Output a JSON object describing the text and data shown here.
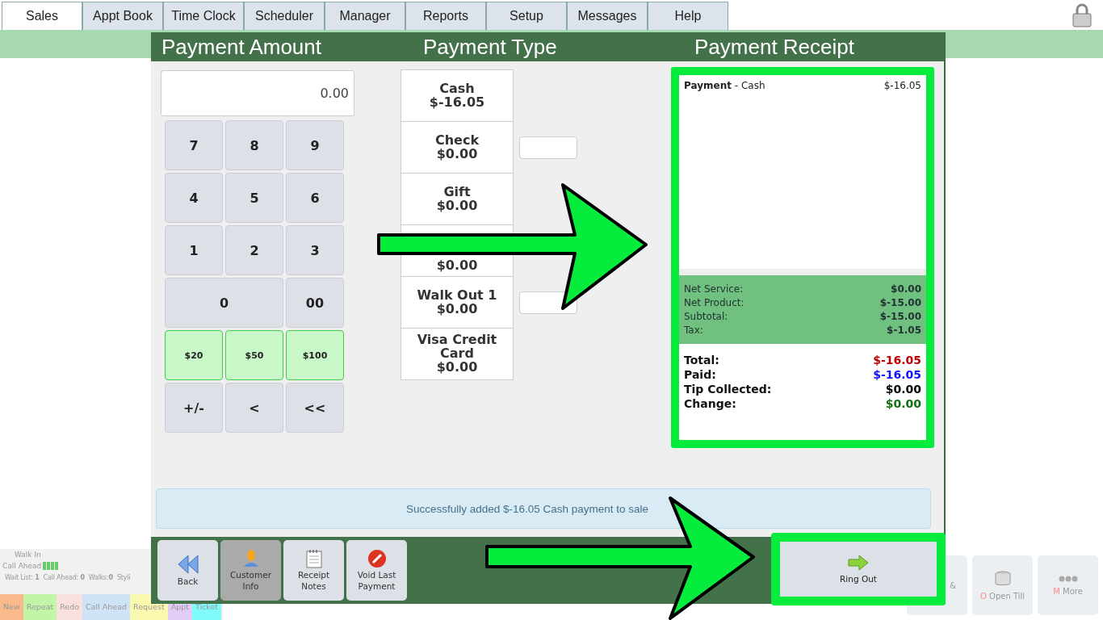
{
  "tabs": [
    {
      "label": "Sales",
      "selected": true
    },
    {
      "label": "Appt Book",
      "selected": false
    },
    {
      "label": "Time Clock",
      "selected": false
    },
    {
      "label": "Scheduler",
      "selected": false
    },
    {
      "label": "Manager",
      "selected": false
    },
    {
      "label": "Reports",
      "selected": false
    },
    {
      "label": "Setup",
      "selected": false
    },
    {
      "label": "Messages",
      "selected": false
    },
    {
      "label": "Help",
      "selected": false
    }
  ],
  "queue": {
    "walk_in_label": "Walk In",
    "call_ahead_label": "Call Ahead",
    "stats": [
      "Wait List: **1**",
      "Call Ahead: **0**",
      "Walks:**0**",
      "Styli"
    ],
    "types": [
      {
        "label": "New",
        "color": "#f9b98a"
      },
      {
        "label": "Repeat",
        "color": "#c2f5a8"
      },
      {
        "label": "Redo",
        "color": "#fbe0e0"
      },
      {
        "label": "Call Ahead",
        "color": "#cfe3f7"
      },
      {
        "label": "Request",
        "color": "#fbf8b0"
      },
      {
        "label": "Appt",
        "color": "#e2cdf7"
      },
      {
        "label": "Ticket",
        "color": "#80fbfb"
      }
    ]
  },
  "background_actions": [
    {
      "label": "&"
    },
    {
      "hotkey": "O",
      "label": "Open Till"
    },
    {
      "hotkey": "M",
      "label": "More"
    }
  ],
  "modal": {
    "headers": [
      "Payment Amount",
      "Payment Type",
      "Payment Receipt"
    ],
    "amount": {
      "value": "0.00"
    },
    "keys": [
      {
        "label": "7",
        "kind": "digit"
      },
      {
        "label": "8",
        "kind": "digit"
      },
      {
        "label": "9",
        "kind": "digit"
      },
      {
        "label": "4",
        "kind": "digit"
      },
      {
        "label": "5",
        "kind": "digit"
      },
      {
        "label": "6",
        "kind": "digit"
      },
      {
        "label": "1",
        "kind": "digit"
      },
      {
        "label": "2",
        "kind": "digit"
      },
      {
        "label": "3",
        "kind": "digit"
      },
      {
        "label": "0",
        "kind": "wide"
      },
      {
        "label": "00",
        "kind": "digit"
      },
      {
        "label": "$20",
        "kind": "cash"
      },
      {
        "label": "$50",
        "kind": "cash"
      },
      {
        "label": "$100",
        "kind": "cash"
      },
      {
        "label": "+/-",
        "kind": "digit"
      },
      {
        "label": "<",
        "kind": "digit"
      },
      {
        "label": "<<",
        "kind": "digit"
      }
    ],
    "payment_types": [
      {
        "name": "Cash",
        "amount": "$-16.05",
        "has_field": false
      },
      {
        "name": "Check",
        "amount": "$0.00",
        "has_field": true
      },
      {
        "name": "Gift",
        "amount": "$0.00",
        "has_field": false
      },
      {
        "amount": "$0.00",
        "has_field": false
      },
      {
        "name": "Walk Out 1",
        "amount": "$0.00",
        "has_field": true
      },
      {
        "name": "Visa Credit Card",
        "amount": "$0.00",
        "has_field": false
      }
    ],
    "receipt": {
      "line": {
        "label": "Payment",
        "separator": "-",
        "detail": "Cash",
        "amount": "$-16.05"
      },
      "summary": [
        {
          "label": "Net Service:",
          "value": "$0.00"
        },
        {
          "label": "Net Product:",
          "value": "$-15.00"
        },
        {
          "label": "Subtotal:",
          "value": "$-15.00"
        },
        {
          "label": "Tax:",
          "value": "$-1.05"
        }
      ],
      "totals": [
        {
          "label": "Total:",
          "value": "$-16.05",
          "color": "#c00000"
        },
        {
          "label": "Paid:",
          "value": "$-16.05",
          "color": "#1010ff"
        },
        {
          "label": "Tip Collected:",
          "value": "$0.00",
          "color": "#000000"
        },
        {
          "label": "Change:",
          "value": "$0.00",
          "color": "#107010"
        }
      ]
    },
    "message": "Successfully added $-16.05 Cash payment to sale",
    "footer_buttons": [
      {
        "label": "Back",
        "selected": false
      },
      {
        "label": "Customer Info",
        "selected": true
      },
      {
        "label": "Receipt Notes",
        "selected": false
      },
      {
        "label": "Void Last Payment",
        "selected": false
      }
    ],
    "ring_out": {
      "label": "Ring Out"
    }
  }
}
